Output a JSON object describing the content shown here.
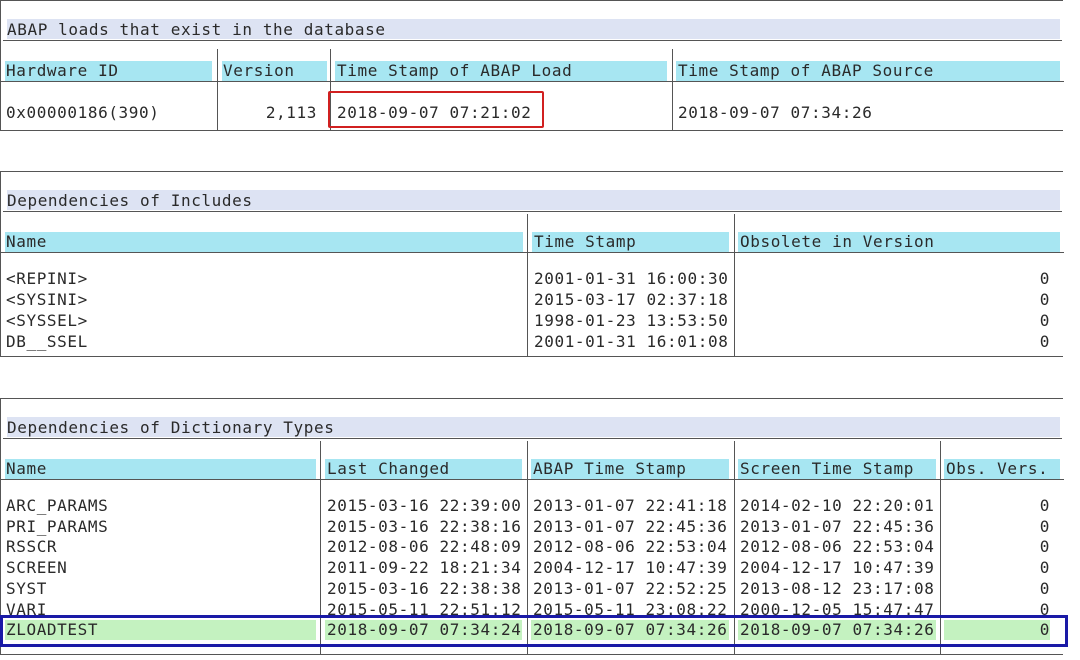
{
  "loads": {
    "title": "ABAP loads that exist in the database",
    "headers": [
      "Hardware ID",
      "Version",
      "Time Stamp of ABAP Load",
      "Time Stamp of ABAP Source"
    ],
    "row": {
      "hardware_id": "0x00000186(390)",
      "version": "2,113",
      "load_ts": "2018-09-07 07:21:02",
      "source_ts": "2018-09-07 07:34:26"
    }
  },
  "includes": {
    "title": "Dependencies of Includes",
    "headers": [
      "Name",
      "Time Stamp",
      "Obsolete in Version"
    ],
    "rows": [
      {
        "name": "<REPINI>",
        "ts": "2001-01-31 16:00:30",
        "obs": "0"
      },
      {
        "name": "<SYSINI>",
        "ts": "2015-03-17 02:37:18",
        "obs": "0"
      },
      {
        "name": "<SYSSEL>",
        "ts": "1998-01-23 13:53:50",
        "obs": "0"
      },
      {
        "name": "DB__SSEL",
        "ts": "2001-01-31 16:01:08",
        "obs": "0"
      }
    ]
  },
  "dict_types": {
    "title": "Dependencies of Dictionary Types",
    "headers": [
      "Name",
      "Last Changed",
      "ABAP Time Stamp",
      "Screen Time Stamp",
      "Obs. Vers."
    ],
    "rows": [
      {
        "name": "ARC_PARAMS",
        "last": "2015-03-16 22:39:00",
        "abap": "2013-01-07 22:41:18",
        "screen": "2014-02-10 22:20:01",
        "obs": "0"
      },
      {
        "name": "PRI_PARAMS",
        "last": "2015-03-16 22:38:16",
        "abap": "2013-01-07 22:45:36",
        "screen": "2013-01-07 22:45:36",
        "obs": "0"
      },
      {
        "name": "RSSCR",
        "last": "2012-08-06 22:48:09",
        "abap": "2012-08-06 22:53:04",
        "screen": "2012-08-06 22:53:04",
        "obs": "0"
      },
      {
        "name": "SCREEN",
        "last": "2011-09-22 18:21:34",
        "abap": "2004-12-17 10:47:39",
        "screen": "2004-12-17 10:47:39",
        "obs": "0"
      },
      {
        "name": "SYST",
        "last": "2015-03-16 22:38:38",
        "abap": "2013-01-07 22:52:25",
        "screen": "2013-08-12 23:17:08",
        "obs": "0"
      },
      {
        "name": "VARI",
        "last": "2015-05-11 22:51:12",
        "abap": "2015-05-11 23:08:22",
        "screen": "2000-12-05 15:47:47",
        "obs": "0"
      },
      {
        "name": "ZLOADTEST",
        "last": "2018-09-07 07:34:24",
        "abap": "2018-09-07 07:34:26",
        "screen": "2018-09-07 07:34:26",
        "obs": "0"
      }
    ]
  },
  "colors": {
    "header_cell": "#a7e6f2",
    "section_title": "#dde3f3",
    "highlight_row": "#c4f2c0",
    "red_box": "#d12020",
    "blue_box": "#1a1aa6"
  }
}
